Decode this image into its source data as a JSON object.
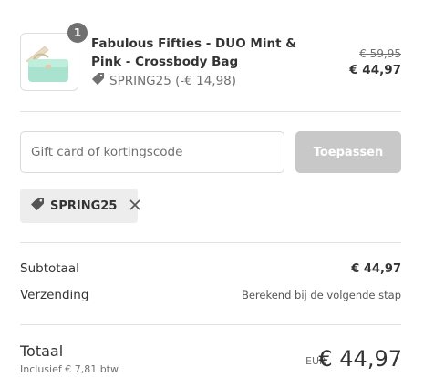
{
  "product": {
    "quantity": "1",
    "title": "Fabulous Fifties - DUO Mint & Pink - Crossbody Bag",
    "discount_text": "SPRING25 (-€ 14,98)",
    "price_original": "€ 59,95",
    "price_final": "€ 44,97",
    "image_icon": "mint-crossbody-bag-image"
  },
  "discount_form": {
    "placeholder": "Gift card of kortingscode",
    "value": "",
    "apply_label": "Toepassen"
  },
  "applied_code": {
    "code": "SPRING25",
    "remove_icon": "close-icon"
  },
  "summary": {
    "subtotal_label": "Subtotaal",
    "subtotal_value": "€ 44,97",
    "shipping_label": "Verzending",
    "shipping_value": "Berekend bij de volgende stap"
  },
  "total": {
    "label": "Totaal",
    "tax_note": "Inclusief € 7,81 btw",
    "currency": "EUR",
    "value": "€ 44,97"
  },
  "colors": {
    "button_disabled": "#c8c8c8",
    "tag_bg": "#ededed",
    "badge": "#707070",
    "bag_mint": "#a9e3cf",
    "bag_pink": "#f4d6d6"
  }
}
